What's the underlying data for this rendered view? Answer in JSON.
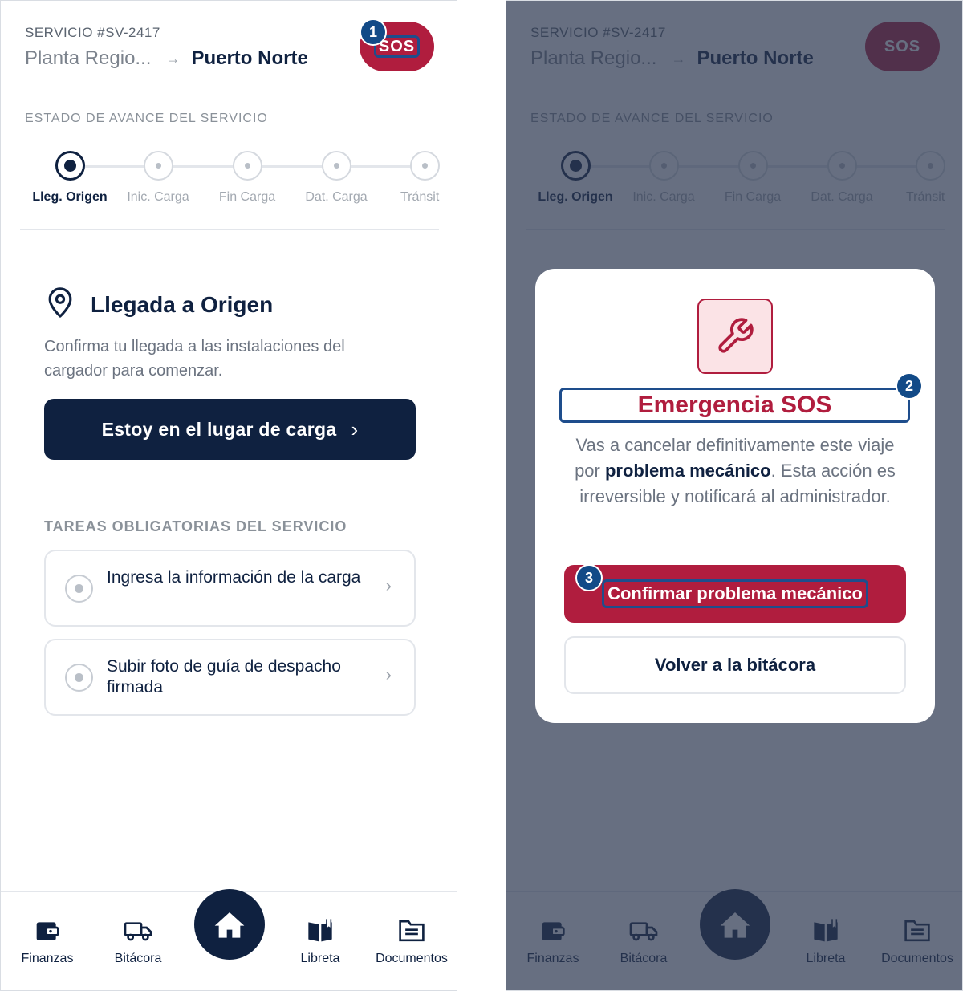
{
  "header": {
    "service_id": "SERVICIO #SV-2417",
    "origin": "Planta Regio...",
    "arrow": "→",
    "destination": "Puerto Norte",
    "sos_label": "SOS"
  },
  "progress": {
    "section_label": "ESTADO DE AVANCE DEL SERVICIO",
    "steps": [
      {
        "label": "Lleg. Origen",
        "active": true
      },
      {
        "label": "Inic. Carga",
        "active": false
      },
      {
        "label": "Fin Carga",
        "active": false
      },
      {
        "label": "Dat. Carga",
        "active": false
      },
      {
        "label": "Tránsit",
        "active": false
      }
    ]
  },
  "task": {
    "title": "Llegada a Origen",
    "description": "Confirma tu llegada a las instalaciones del cargador para comenzar.",
    "button_label": "Estoy en el lugar de carga",
    "button_chevron": "›"
  },
  "required_tasks": {
    "section_label": "TAREAS OBLIGATORIAS DEL SERVICIO",
    "items": [
      {
        "label": "Ingresa la información de la carga"
      },
      {
        "label": "Subir foto de guía de despacho firmada"
      }
    ],
    "chevron": "›"
  },
  "nav": {
    "items": [
      {
        "label": "Finanzas",
        "icon": "wallet-icon"
      },
      {
        "label": "Bitácora",
        "icon": "truck-icon"
      },
      {
        "label": "",
        "icon": "home-icon"
      },
      {
        "label": "Libreta",
        "icon": "book-icon"
      },
      {
        "label": "Documentos",
        "icon": "documents-icon"
      }
    ]
  },
  "modal": {
    "icon": "wrench-icon",
    "title": "Emergencia SOS",
    "body_before": "Vas a cancelar definitivamente este viaje por ",
    "body_bold": "problema mecánico",
    "body_after": ". Esta acción es irreversible y notificará al administrador.",
    "confirm_label": "Confirmar problema mecánico",
    "back_label": "Volver a la bitácora"
  },
  "markers": [
    "1",
    "2",
    "3"
  ],
  "colors": {
    "navy": "#0f2140",
    "sos_red": "#b01d3e",
    "marker_blue": "#124a87",
    "overlay": "rgba(45,55,80,0.72)"
  }
}
